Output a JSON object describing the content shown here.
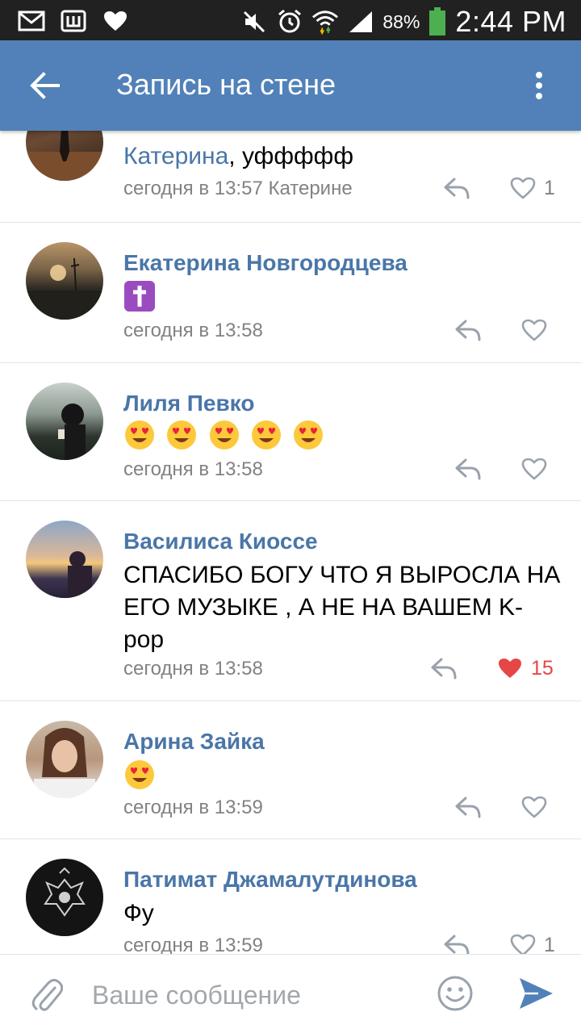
{
  "status_bar": {
    "battery": "88%",
    "time": "2:44 PM",
    "left_icons": [
      "mail-icon",
      "vk-icon",
      "heart-icon"
    ],
    "right_icons": [
      "mute-icon",
      "alarm-icon",
      "wifi-icon",
      "signal-icon",
      "battery-icon"
    ]
  },
  "app_bar": {
    "title": "Запись на стене",
    "back_icon": "arrow-back-icon",
    "menu_icon": "more-vert-icon",
    "color": "#5181b8"
  },
  "comments": [
    {
      "name": "",
      "mention": "Катерина",
      "text": ", уффффф",
      "meta": "сегодня в 13:57 Катерине",
      "likes": "1",
      "liked": false
    },
    {
      "name": "Екатерина Новгородцева",
      "text_emoji": "latin-cross-emoji",
      "meta": "сегодня в 13:58",
      "likes": "",
      "liked": false
    },
    {
      "name": "Лиля Певко",
      "text_emoji": "heart-eyes-emoji x5",
      "meta": "сегодня в 13:58",
      "likes": "",
      "liked": false
    },
    {
      "name": "Василиса Киоссе",
      "text": "СПАСИБО БОГУ ЧТО Я ВЫРОСЛА НА ЕГО МУЗЫКЕ , А НЕ НА ВАШЕМ K-pop",
      "meta": "сегодня в 13:58",
      "likes": "15",
      "liked": true
    },
    {
      "name": "Арина Зайка",
      "text_emoji": "heart-eyes-emoji",
      "meta": "сегодня в 13:59",
      "likes": "",
      "liked": false
    },
    {
      "name": "Патимат Джамалутдинова",
      "text": "Фу",
      "meta": "сегодня в 13:59",
      "likes": "1",
      "liked": false
    }
  ],
  "composer": {
    "placeholder": "Ваше сообщение",
    "attach_icon": "paperclip-icon",
    "emoji_icon": "smiley-icon",
    "send_icon": "send-icon"
  },
  "colors": {
    "link": "#4a76a8",
    "meta": "#828282",
    "liked": "#e64646",
    "icon_gray": "#99a2ad",
    "send": "#5181b8"
  }
}
